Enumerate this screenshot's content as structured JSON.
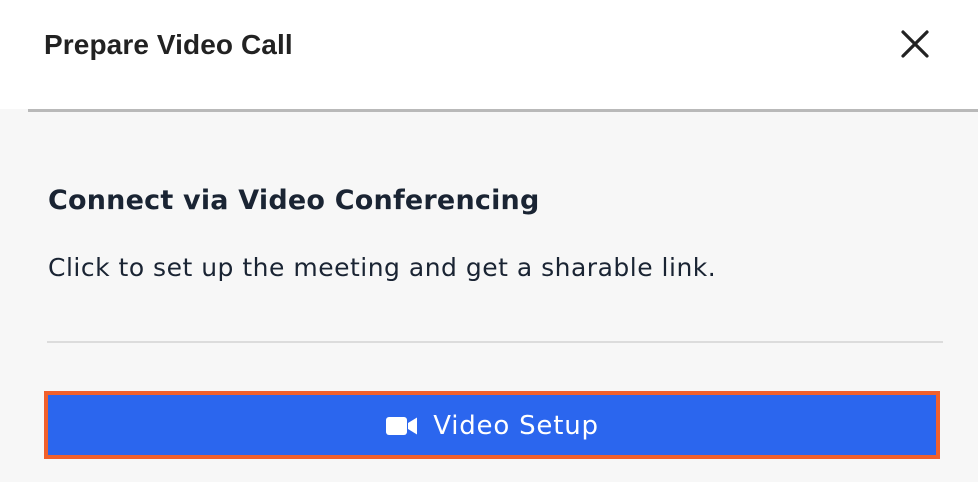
{
  "dialog": {
    "title": "Prepare Video Call",
    "close_icon": "close-icon"
  },
  "content": {
    "heading": "Connect via Video Conferencing",
    "description": "Click to set up the meeting and get a sharable link."
  },
  "video_setup_button": {
    "label": "Video Setup",
    "icon": "video-camera-icon",
    "background_color": "#2b66ee",
    "highlight_border_color": "#f1602c"
  }
}
